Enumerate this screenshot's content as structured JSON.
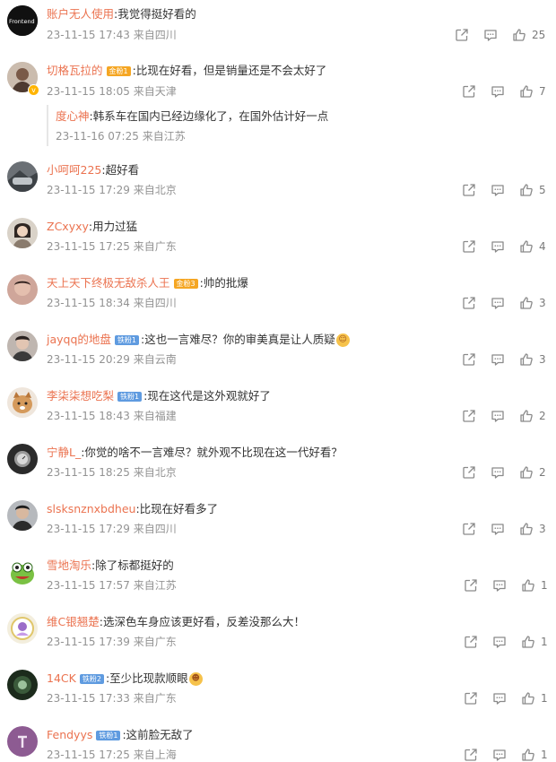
{
  "comments": [
    {
      "user": "账户无人使用",
      "text": ":我觉得挺好看的",
      "time": "23-11-15 17:43",
      "location": "来自四川",
      "likes": "25"
    },
    {
      "user": "切格瓦拉的",
      "badge": "金粉1",
      "text": ":比现在好看，但是销量还是不会太好了",
      "time": "23-11-15 18:05",
      "location": "来自天津",
      "likes": "7",
      "reply": {
        "user": "度心神",
        "text": ":韩系车在国内已经边缘化了，在国外估计好一点",
        "time": "23-11-16 07:25",
        "location": "来自江苏"
      }
    },
    {
      "user": "小呵呵225",
      "text": ":超好看",
      "time": "23-11-15 17:29",
      "location": "来自北京",
      "likes": "5"
    },
    {
      "user": "ZCxyxy",
      "text": ":用力过猛",
      "time": "23-11-15 17:25",
      "location": "来自广东",
      "likes": "4"
    },
    {
      "user": "天上天下终极无敌杀人王",
      "badge": "金粉3",
      "text": ":帅的批爆",
      "time": "23-11-15 18:34",
      "location": "来自四川",
      "likes": "3"
    },
    {
      "user": "jayqq的地盘",
      "badge": "铁粉1",
      "text": ":这也一言难尽？你的审美真是让人质疑",
      "time": "23-11-15 20:29",
      "location": "来自云南",
      "likes": "3"
    },
    {
      "user": "李柒柒想吃梨",
      "badge": "铁粉1",
      "text": ":现在这代是这外观就好了",
      "time": "23-11-15 18:43",
      "location": "来自福建",
      "likes": "2"
    },
    {
      "user": "宁静L_",
      "text": ":你觉的啥不一言难尽？就外观不比现在这一代好看？",
      "time": "23-11-15 18:25",
      "location": "来自北京",
      "likes": "2"
    },
    {
      "user": "slsksnznxbdheu",
      "text": ":比现在好看多了",
      "time": "23-11-15 17:29",
      "location": "来自四川",
      "likes": "3"
    },
    {
      "user": "雪地淘乐",
      "text": ":除了标都挺好的",
      "time": "23-11-15 17:57",
      "location": "来自江苏",
      "likes": "1"
    },
    {
      "user": "维C银翘楚",
      "text": ":选深色车身应该更好看，反差没那么大！",
      "time": "23-11-15 17:39",
      "location": "来自广东",
      "likes": "1"
    },
    {
      "user": "14CK",
      "badge": "铁粉2",
      "text": ":至少比现款顺眼",
      "time": "23-11-15 17:33",
      "location": "来自广东",
      "likes": "1"
    },
    {
      "user": "Fendyys",
      "badge": "铁粉1",
      "text": ":这前脸无敌了",
      "time": "23-11-15 17:25",
      "location": "来自上海",
      "likes": "1"
    }
  ],
  "avatar_logo_text": "Frontend",
  "colors": {
    "username": "#eb7350",
    "meta": "#939393",
    "text": "#333333",
    "gold_badge": "#f5a623",
    "iron_badge": "#5f9be0"
  },
  "icons": {
    "share": "share-icon",
    "comment": "comment-icon",
    "like": "like-icon"
  }
}
